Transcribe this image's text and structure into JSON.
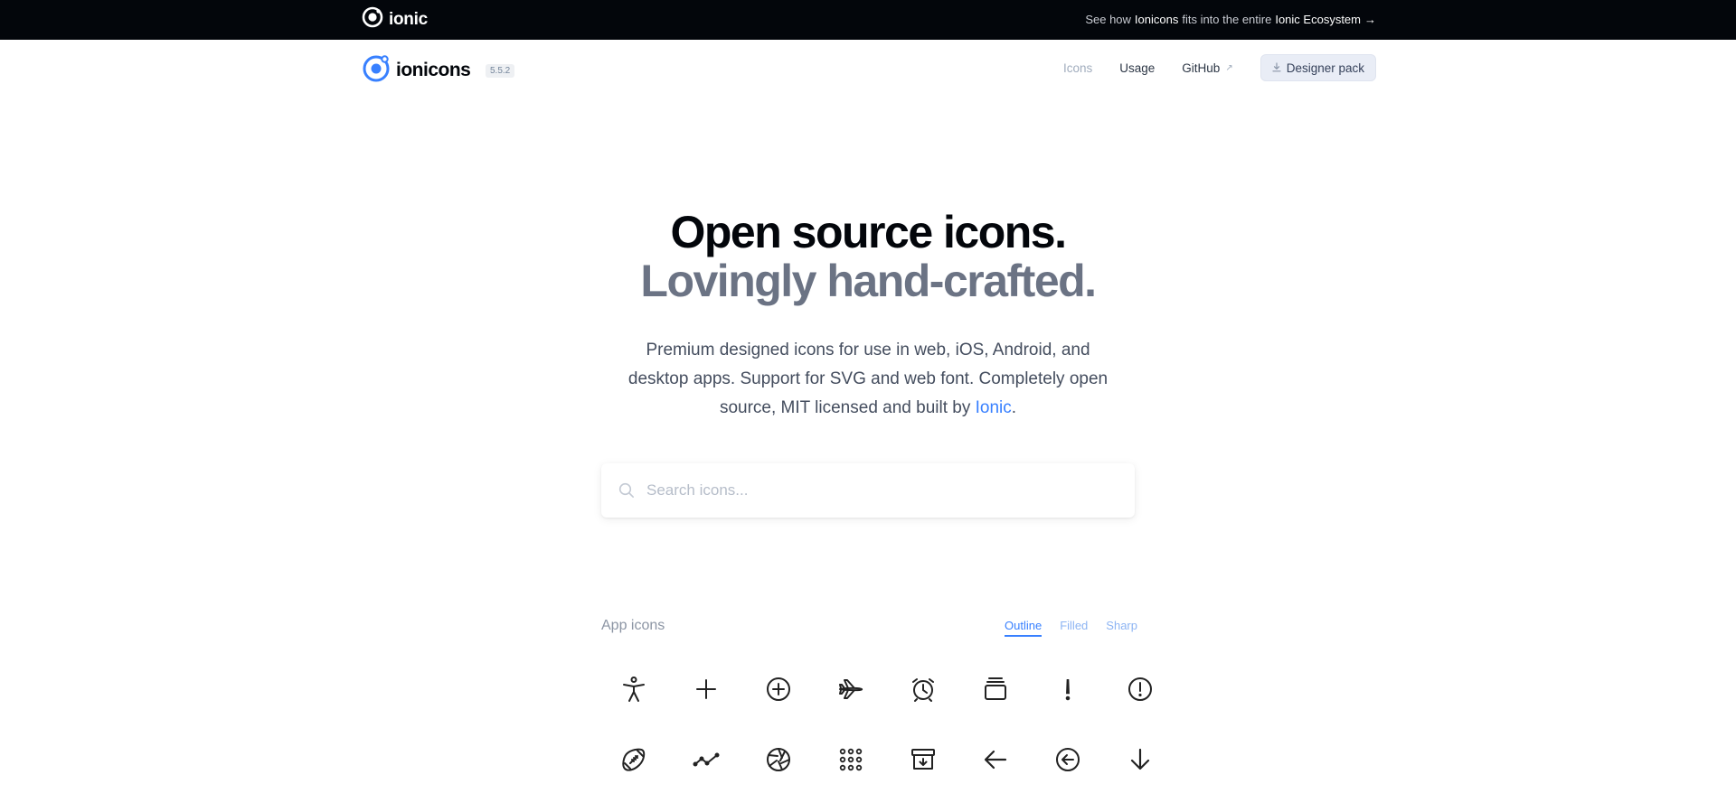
{
  "topbar": {
    "brand": "ionic",
    "promo_prefix": "See how",
    "promo_highlight": "Ionicons",
    "promo_middle": "fits into the entire",
    "promo_link": "Ionic Ecosystem",
    "promo_arrow": "→"
  },
  "header": {
    "logo_text": "ionicons",
    "version": "5.5.2",
    "nav": {
      "icons": "Icons",
      "usage": "Usage",
      "github": "GitHub",
      "github_ext": "↗",
      "designer_pack": "Designer pack"
    }
  },
  "hero": {
    "title": "Open source icons.",
    "subtitle": "Lovingly hand-crafted.",
    "description": "Premium designed icons for use in web, iOS, Android, and desktop apps. Support for SVG and web font. Completely open source, MIT licensed and built by",
    "description_link": "Ionic",
    "description_end": "."
  },
  "search": {
    "placeholder": "Search icons..."
  },
  "icons_section": {
    "title": "App icons",
    "tabs": [
      "Outline",
      "Filled",
      "Sharp"
    ],
    "active_tab": "Outline",
    "icons": [
      "accessibility-icon",
      "add-icon",
      "add-circle-icon",
      "airplane-icon",
      "alarm-icon",
      "albums-icon",
      "alert-icon",
      "alert-circle-icon",
      "american-football-icon",
      "analytics-icon",
      "aperture-icon",
      "apps-icon",
      "archive-icon",
      "arrow-back-icon",
      "arrow-back-circle-icon",
      "arrow-down-icon"
    ]
  },
  "colors": {
    "topbar_bg": "#03060b",
    "accent": "#3880ff",
    "subtitle_gray": "#6b7384"
  }
}
